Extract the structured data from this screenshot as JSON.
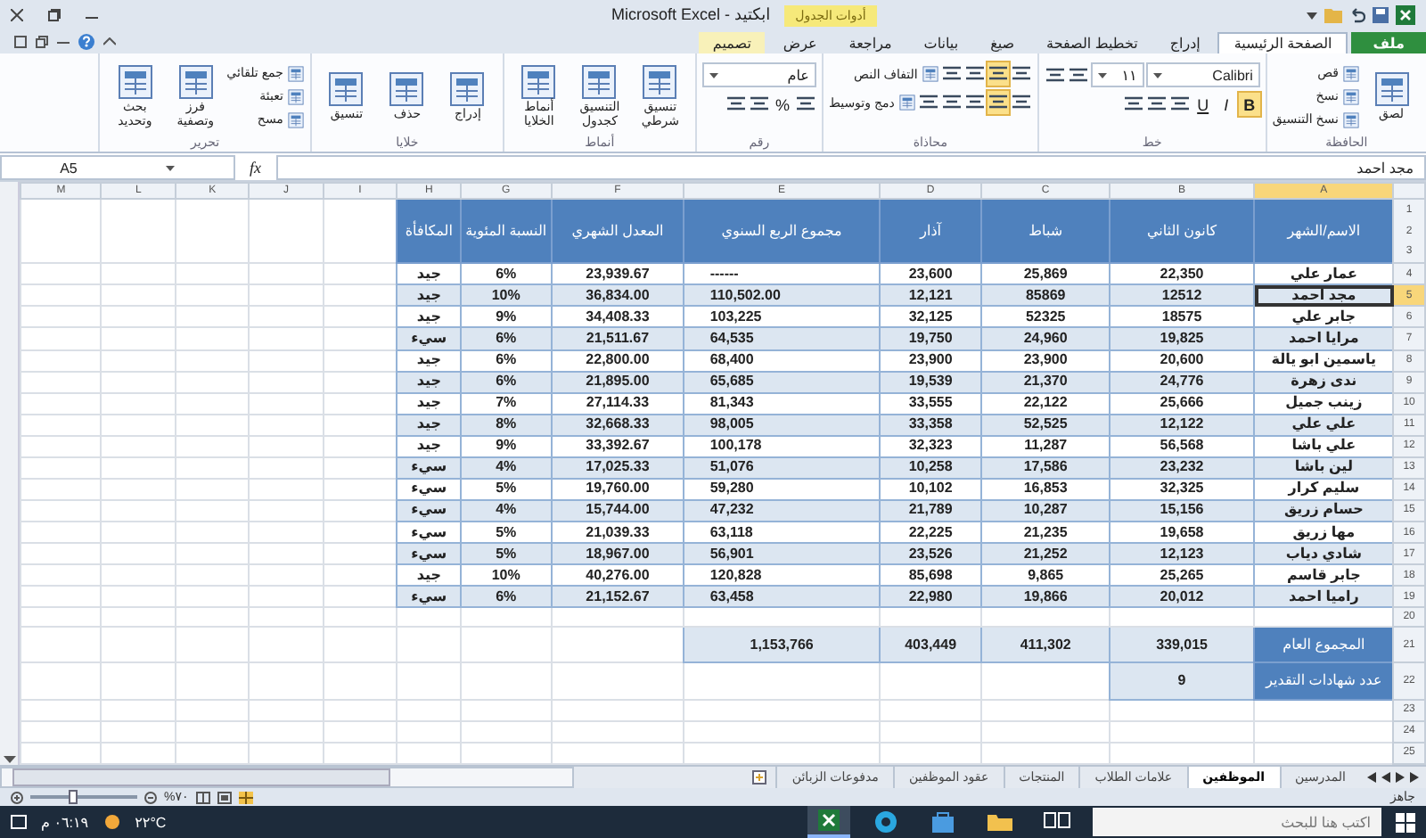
{
  "window": {
    "title": "ابكتيد - Microsoft Excel",
    "context_group": "أدوات الجدول"
  },
  "ribbon_tabs": [
    {
      "label": "ملف",
      "kind": "file",
      "selected": false
    },
    {
      "label": "الصفحة الرئيسية",
      "kind": "tab",
      "selected": true
    },
    {
      "label": "إدراج",
      "kind": "tab",
      "selected": false
    },
    {
      "label": "تخطيط الصفحة",
      "kind": "tab",
      "selected": false
    },
    {
      "label": "صيغ",
      "kind": "tab",
      "selected": false
    },
    {
      "label": "بيانات",
      "kind": "tab",
      "selected": false
    },
    {
      "label": "مراجعة",
      "kind": "tab",
      "selected": false
    },
    {
      "label": "عرض",
      "kind": "tab",
      "selected": false
    },
    {
      "label": "تصميم",
      "kind": "context",
      "selected": false
    }
  ],
  "ribbon_groups": [
    {
      "label": "الحافظة",
      "columns": [
        {
          "items": [
            {
              "kind": "large",
              "label": "لصق"
            }
          ]
        },
        {
          "items": [
            {
              "kind": "small",
              "label": "قص"
            },
            {
              "kind": "small",
              "label": "نسخ"
            },
            {
              "kind": "small",
              "label": "نسخ التنسيق"
            }
          ]
        }
      ]
    },
    {
      "label": "خط",
      "rows": [
        {
          "items": [
            {
              "kind": "field",
              "label": "Calibri"
            },
            {
              "kind": "short_field",
              "label": "١١"
            },
            {
              "kind": "icon",
              "selected": false
            },
            {
              "kind": "icon",
              "selected": false
            }
          ]
        },
        {
          "items": [
            {
              "kind": "bold",
              "label": "B",
              "selected": true
            },
            {
              "kind": "italic",
              "label": "I",
              "selected": false
            },
            {
              "kind": "underline",
              "label": "U",
              "selected": false
            },
            {
              "kind": "icon",
              "selected": false
            },
            {
              "kind": "icon",
              "selected": false
            },
            {
              "kind": "icon",
              "selected": false
            }
          ]
        }
      ]
    },
    {
      "label": "محاذاة",
      "rows": [
        {
          "items": [
            {
              "kind": "icon",
              "selected": false
            },
            {
              "kind": "icon",
              "selected": true
            },
            {
              "kind": "icon",
              "selected": false
            },
            {
              "kind": "icon",
              "selected": false
            },
            {
              "kind": "small",
              "label": "التفاف النص"
            }
          ]
        },
        {
          "items": [
            {
              "kind": "icon",
              "selected": false
            },
            {
              "kind": "icon",
              "selected": true
            },
            {
              "kind": "icon",
              "selected": false
            },
            {
              "kind": "icon",
              "selected": false
            },
            {
              "kind": "icon",
              "selected": false
            },
            {
              "kind": "small",
              "label": "دمج وتوسيط"
            }
          ]
        }
      ]
    },
    {
      "label": "رقم",
      "rows": [
        {
          "items": [
            {
              "kind": "field",
              "label": "عام"
            }
          ]
        },
        {
          "items": [
            {
              "kind": "icon",
              "selected": false
            },
            {
              "kind": "glyph",
              "label": "%",
              "selected": false
            },
            {
              "kind": "icon",
              "selected": false
            },
            {
              "kind": "icon",
              "selected": false
            }
          ]
        }
      ]
    },
    {
      "label": "أنماط",
      "columns": [
        {
          "items": [
            {
              "kind": "large",
              "label": "تنسيق شرطي"
            }
          ]
        },
        {
          "items": [
            {
              "kind": "large",
              "label": "التنسيق كجدول"
            }
          ]
        },
        {
          "items": [
            {
              "kind": "large",
              "label": "أنماط الخلايا"
            }
          ]
        }
      ]
    },
    {
      "label": "خلايا",
      "columns": [
        {
          "items": [
            {
              "kind": "large",
              "label": "إدراج"
            }
          ]
        },
        {
          "items": [
            {
              "kind": "large",
              "label": "حذف"
            }
          ]
        },
        {
          "items": [
            {
              "kind": "large",
              "label": "تنسيق"
            }
          ]
        }
      ]
    },
    {
      "label": "تحرير",
      "columns": [
        {
          "items": [
            {
              "kind": "small",
              "label": "جمع تلقائي"
            },
            {
              "kind": "small",
              "label": "تعبئة"
            },
            {
              "kind": "small",
              "label": "مسح"
            }
          ]
        },
        {
          "items": [
            {
              "kind": "large",
              "label": "فرز وتصفية"
            }
          ]
        },
        {
          "items": [
            {
              "kind": "large",
              "label": "بحث وتحديد"
            }
          ]
        }
      ]
    }
  ],
  "formula_bar": {
    "name_box": "A5",
    "function_label": "fx",
    "formula": "مجد احمد"
  },
  "sheet": {
    "column_headers": [
      {
        "label": "A",
        "selected": true
      },
      {
        "label": "B",
        "selected": false
      },
      {
        "label": "C",
        "selected": false
      },
      {
        "label": "D",
        "selected": false
      },
      {
        "label": "E",
        "selected": false
      },
      {
        "label": "F",
        "selected": false
      },
      {
        "label": "G",
        "selected": false
      },
      {
        "label": "H",
        "selected": false
      },
      {
        "label": "I",
        "selected": false
      },
      {
        "label": "J",
        "selected": false
      },
      {
        "label": "K",
        "selected": false
      },
      {
        "label": "L",
        "selected": false
      },
      {
        "label": "M",
        "selected": false
      }
    ],
    "header_row_numbers": [
      "1",
      "2",
      "3"
    ],
    "table": {
      "columns": [
        "الاسم/الشهر",
        "كانون الثاني",
        "شباط",
        "آذار",
        "مجموع الربع السنوي",
        "المعدل الشهري",
        "النسبة المئوية",
        "المكافأة"
      ],
      "rows": [
        {
          "row_number": "4",
          "name_cell_selected": false,
          "cells": [
            "عمار علي",
            "22,350",
            "25,869",
            "23,600",
            "------",
            "23,939.67",
            "6%",
            "جيد"
          ]
        },
        {
          "row_number": "5",
          "name_cell_selected": true,
          "cells": [
            "مجد احمد",
            "12512",
            "85869",
            "12,121",
            "110,502.00",
            "36,834.00",
            "10%",
            "جيد"
          ]
        },
        {
          "row_number": "6",
          "name_cell_selected": false,
          "cells": [
            "جابر علي",
            "18575",
            "52325",
            "32,125",
            "103,225",
            "34,408.33",
            "9%",
            "جيد"
          ]
        },
        {
          "row_number": "7",
          "name_cell_selected": false,
          "cells": [
            "مرايا احمد",
            "19,825",
            "24,960",
            "19,750",
            "64,535",
            "21,511.67",
            "6%",
            "سيء"
          ]
        },
        {
          "row_number": "8",
          "name_cell_selected": false,
          "cells": [
            "ياسمين ابو يالة",
            "20,600",
            "23,900",
            "23,900",
            "68,400",
            "22,800.00",
            "6%",
            "جيد"
          ]
        },
        {
          "row_number": "9",
          "name_cell_selected": false,
          "cells": [
            "ندى زهرة",
            "24,776",
            "21,370",
            "19,539",
            "65,685",
            "21,895.00",
            "6%",
            "جيد"
          ]
        },
        {
          "row_number": "10",
          "name_cell_selected": false,
          "cells": [
            "زينب جميل",
            "25,666",
            "22,122",
            "33,555",
            "81,343",
            "27,114.33",
            "7%",
            "جيد"
          ]
        },
        {
          "row_number": "11",
          "name_cell_selected": false,
          "cells": [
            "علي علي",
            "12,122",
            "52,525",
            "33,358",
            "98,005",
            "32,668.33",
            "8%",
            "جيد"
          ]
        },
        {
          "row_number": "12",
          "name_cell_selected": false,
          "cells": [
            "علي باشا",
            "56,568",
            "11,287",
            "32,323",
            "100,178",
            "33,392.67",
            "9%",
            "جيد"
          ]
        },
        {
          "row_number": "13",
          "name_cell_selected": false,
          "cells": [
            "لين باشا",
            "23,232",
            "17,586",
            "10,258",
            "51,076",
            "17,025.33",
            "4%",
            "سيء"
          ]
        },
        {
          "row_number": "14",
          "name_cell_selected": false,
          "cells": [
            "سليم كرار",
            "32,325",
            "16,853",
            "10,102",
            "59,280",
            "19,760.00",
            "5%",
            "سيء"
          ]
        },
        {
          "row_number": "15",
          "name_cell_selected": false,
          "cells": [
            "حسام زريق",
            "15,156",
            "10,287",
            "21,789",
            "47,232",
            "15,744.00",
            "4%",
            "سيء"
          ]
        },
        {
          "row_number": "16",
          "name_cell_selected": false,
          "cells": [
            "مها زريق",
            "19,658",
            "21,235",
            "22,225",
            "63,118",
            "21,039.33",
            "5%",
            "سيء"
          ]
        },
        {
          "row_number": "17",
          "name_cell_selected": false,
          "cells": [
            "شادي دياب",
            "12,123",
            "21,252",
            "23,526",
            "56,901",
            "18,967.00",
            "5%",
            "سيء"
          ]
        },
        {
          "row_number": "18",
          "name_cell_selected": false,
          "cells": [
            "جابر قاسم",
            "25,265",
            "9,865",
            "85,698",
            "120,828",
            "40,276.00",
            "10%",
            "جيد"
          ]
        },
        {
          "row_number": "19",
          "name_cell_selected": false,
          "cells": [
            "راميا احمد",
            "20,012",
            "19,866",
            "22,980",
            "63,458",
            "21,152.67",
            "6%",
            "سيء"
          ]
        }
      ]
    },
    "gap_row_number": "20",
    "summary_rows": [
      {
        "row_number": "21",
        "label": "المجموع العام",
        "cells": [
          "339,015",
          "411,302",
          "403,449",
          "1,153,766"
        ]
      },
      {
        "row_number": "22",
        "label": "عدد شهادات التقدير",
        "cells": [
          "9"
        ]
      }
    ],
    "empty_row_numbers": [
      "23",
      "24",
      "25"
    ]
  },
  "sheet_tabs": [
    {
      "label": "المدرسين",
      "selected": false
    },
    {
      "label": "الموظفين",
      "selected": true
    },
    {
      "label": "علامات الطلاب",
      "selected": false
    },
    {
      "label": "المنتجات",
      "selected": false
    },
    {
      "label": "عقود الموظفين",
      "selected": false
    },
    {
      "label": "مدفوعات الزبائن",
      "selected": false
    }
  ],
  "status_bar": {
    "status": "جاهز",
    "zoom": "%٧٠",
    "zoom_slider": {
      "level": 0.4
    }
  },
  "taskbar": {
    "search": {
      "placeholder": "اكتب هنا للبحث"
    },
    "apps": [
      {
        "kind": "task_view",
        "selected": false
      },
      {
        "kind": "folder",
        "selected": false
      },
      {
        "kind": "store",
        "selected": false
      },
      {
        "kind": "browser",
        "selected": false
      },
      {
        "kind": "spreadsheet",
        "selected": true
      }
    ],
    "weather": "٢٢°C",
    "clock": "٠٦:١٩ م"
  }
}
